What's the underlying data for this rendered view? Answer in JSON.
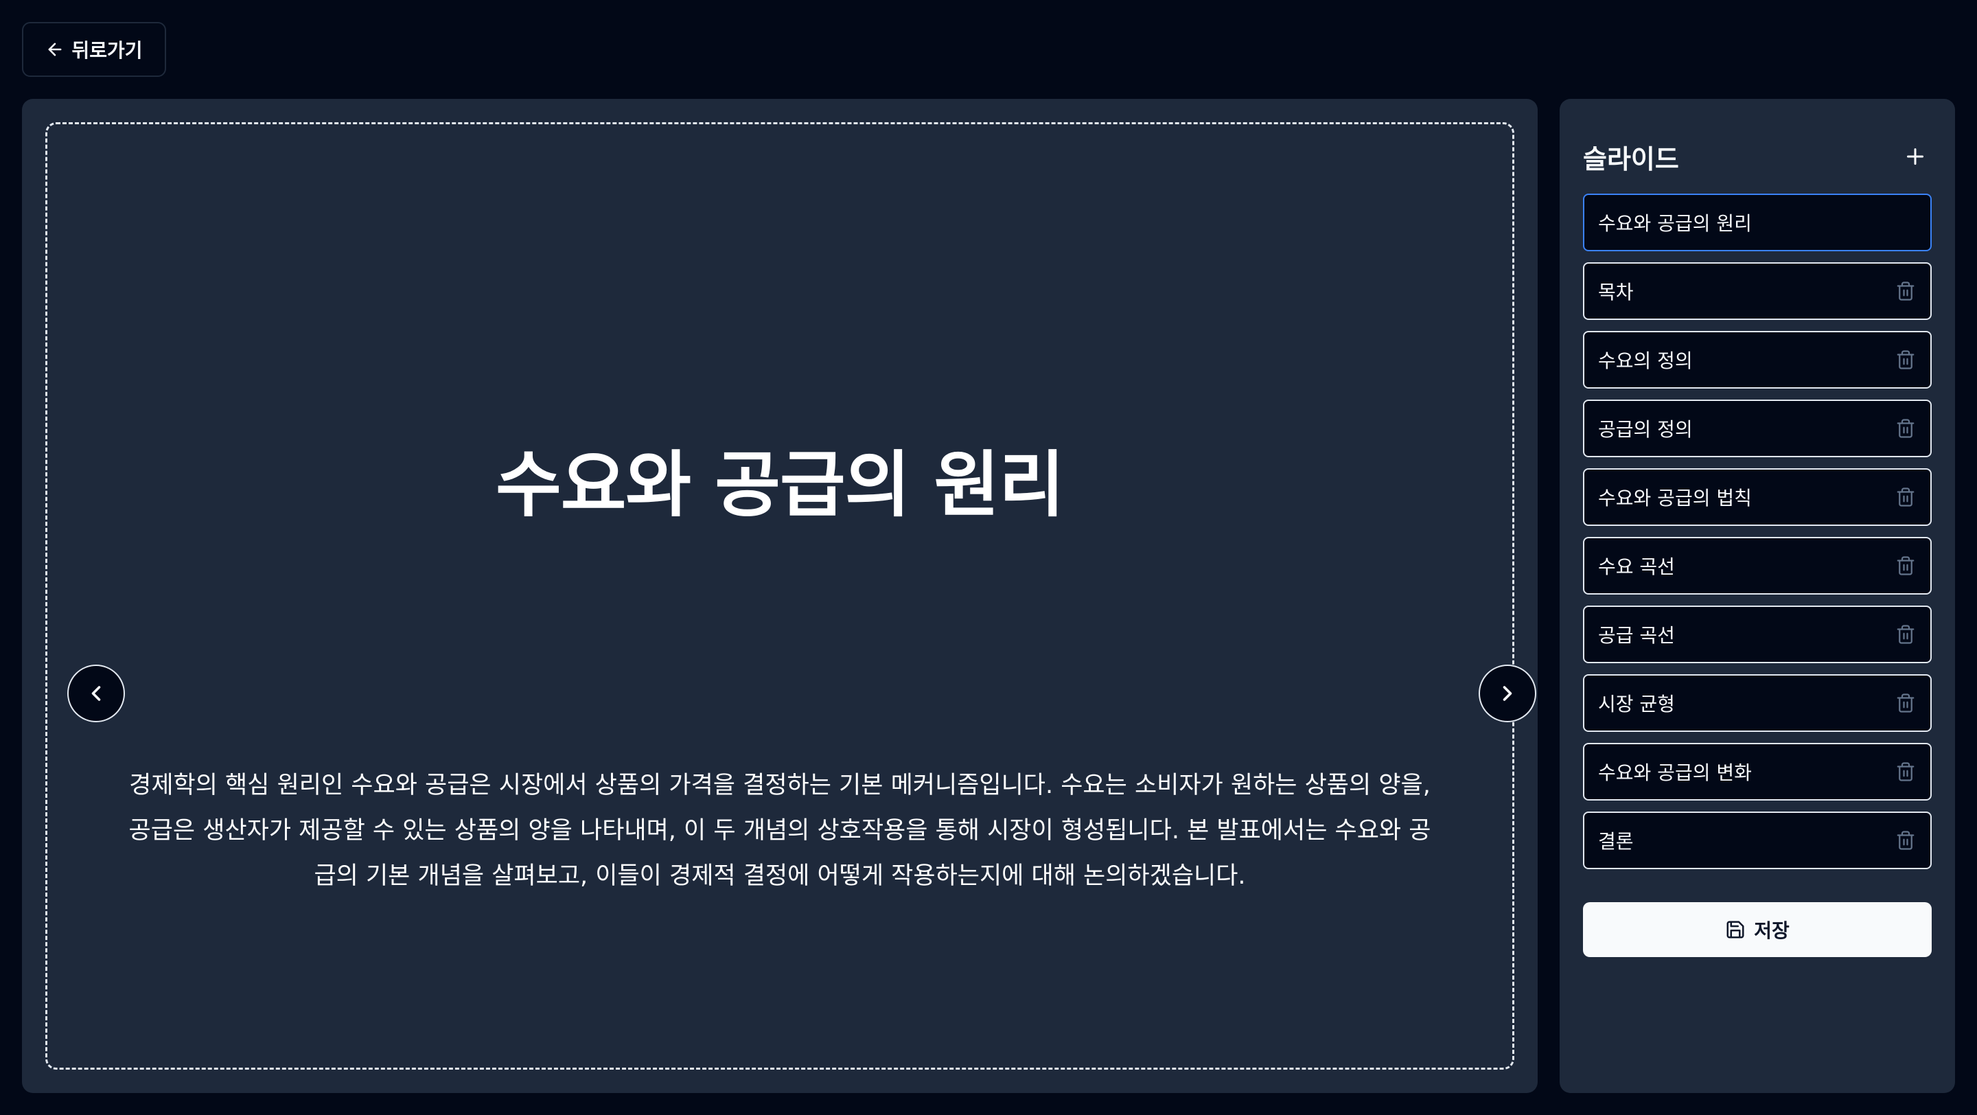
{
  "header": {
    "back_label": "뒤로가기",
    "back_icon": "arrow-left-icon"
  },
  "slide": {
    "title": "수요와 공급의 원리",
    "body": "경제학의 핵심 원리인 수요와 공급은 시장에서 상품의 가격을 결정하는 기본 메커니즘입니다. 수요는 소비자가 원하는 상품의 양을, 공급은 생산자가 제공할 수 있는 상품의 양을 나타내며, 이 두 개념의 상호작용을 통해 시장이 형성됩니다. 본 발표에서는 수요와 공급의 기본 개념을 살펴보고, 이들이 경제적 결정에 어떻게 작용하는지에 대해 논의하겠습니다."
  },
  "sidebar": {
    "title": "슬라이드",
    "add_icon": "plus-icon",
    "items": [
      {
        "label": "수요와 공급의 원리",
        "active": true
      },
      {
        "label": "목차",
        "active": false
      },
      {
        "label": "수요의 정의",
        "active": false
      },
      {
        "label": "공급의 정의",
        "active": false
      },
      {
        "label": "수요와 공급의 법칙",
        "active": false
      },
      {
        "label": "수요 곡선",
        "active": false
      },
      {
        "label": "공급 곡선",
        "active": false
      },
      {
        "label": "시장 균형",
        "active": false
      },
      {
        "label": "수요와 공급의 변화",
        "active": false
      },
      {
        "label": "결론",
        "active": false
      }
    ],
    "save_label": "저장",
    "save_icon": "save-icon"
  },
  "colors": {
    "background": "#020817",
    "panel": "#1e293b",
    "active_border": "#3b82f6",
    "save_bg": "#f8fafc"
  }
}
